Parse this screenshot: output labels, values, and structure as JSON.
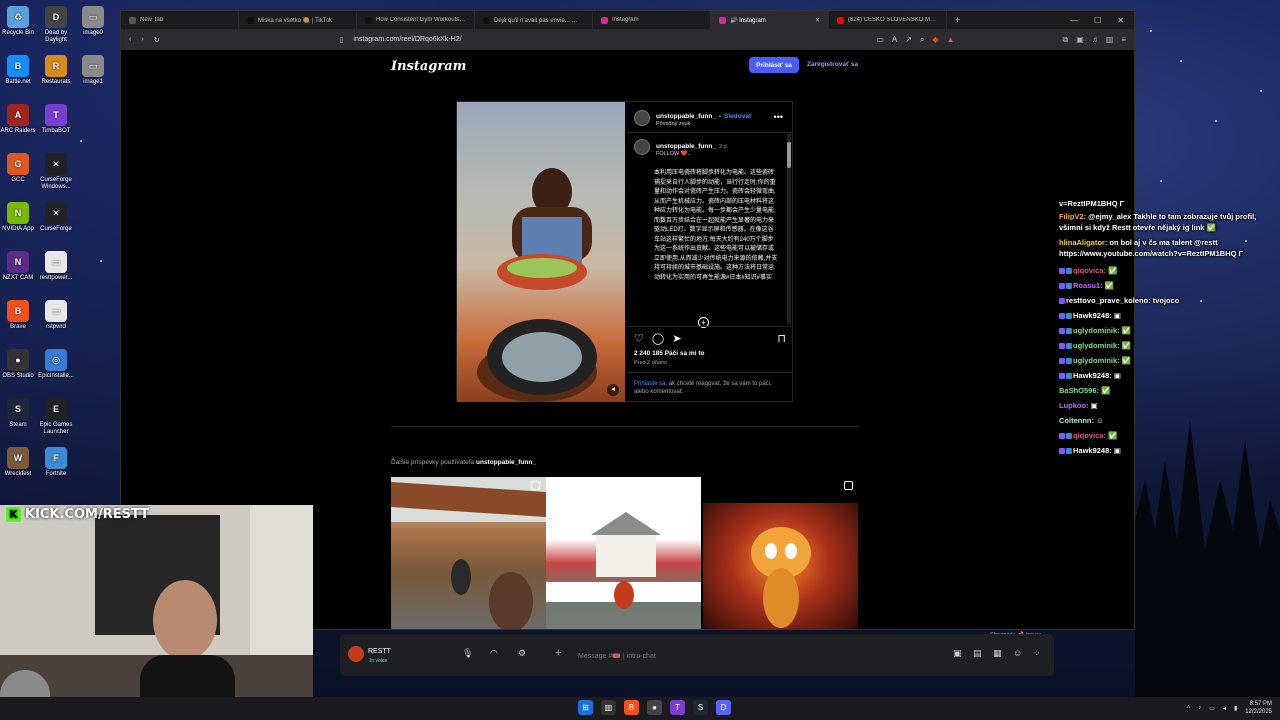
{
  "desktop": {
    "icons": [
      {
        "label": "Recycle Bin",
        "color": "#5aa0d8",
        "glyph": "♻"
      },
      {
        "label": "Dead by Daylight",
        "color": "#444444",
        "glyph": "D"
      },
      {
        "label": "image0",
        "color": "#8a8a8a",
        "glyph": "▭"
      },
      {
        "label": "Battle.net",
        "color": "#148eff",
        "glyph": "B"
      },
      {
        "label": "Restaurats",
        "color": "#d88a1a",
        "glyph": "R"
      },
      {
        "label": "image1",
        "color": "#8a8a8a",
        "glyph": "▭"
      },
      {
        "label": "ARC Raiders",
        "color": "#a2241e",
        "glyph": "A"
      },
      {
        "label": "TimbaBOT",
        "color": "#7b3fd0",
        "glyph": "T"
      },
      {
        "label": "GCC",
        "color": "#e0561f",
        "glyph": "G"
      },
      {
        "label": "CurseForge Windows...",
        "color": "#222222",
        "glyph": "✕"
      },
      {
        "label": "NVIDIA App",
        "color": "#76b900",
        "glyph": "N"
      },
      {
        "label": "CurseForge",
        "color": "#222222",
        "glyph": "✕"
      },
      {
        "label": "NZXT CAM",
        "color": "#5a2b8a",
        "glyph": "N"
      },
      {
        "label": "resttpower...",
        "color": "#e8e8e8",
        "glyph": "▭"
      },
      {
        "label": "Brave",
        "color": "#f1511b",
        "glyph": "B"
      },
      {
        "label": "rstpwrd",
        "color": "#e8e8e8",
        "glyph": "▭"
      },
      {
        "label": "OBS Studio",
        "color": "#333333",
        "glyph": "●"
      },
      {
        "label": "EpicInstalle...",
        "color": "#3a7bd5",
        "glyph": "◎"
      },
      {
        "label": "Steam",
        "color": "#1b2838",
        "glyph": "S"
      },
      {
        "label": "Epic Games Launcher",
        "color": "#222222",
        "glyph": "E"
      },
      {
        "label": "Wreckfest",
        "color": "#7a5a3a",
        "glyph": "W"
      },
      {
        "label": "Fortnite",
        "color": "#3a8ad5",
        "glyph": "F"
      }
    ]
  },
  "browser": {
    "tabs": [
      {
        "title": "New Tab",
        "color": "#555555",
        "active": false
      },
      {
        "title": "Miska na všetko 🥘 | TikTok",
        "color": "#111111",
        "active": false
      },
      {
        "title": "How Consistent Gym Workouts Boo",
        "color": "#111111",
        "active": false
      },
      {
        "title": "Déjà qu'il n'avait pas envie... 😂 #chi",
        "color": "#111111",
        "active": false
      },
      {
        "title": "Instagram",
        "color": "#d6249f",
        "active": false
      },
      {
        "title": "🔊 Instagram",
        "color": "#d6249f",
        "active": true
      },
      {
        "title": "(624) ČESKO SLOVENSKO MÁ TALEN",
        "color": "#ff0000",
        "active": false
      }
    ],
    "url": "instagram.com/reel/DRqo6kXk-H2/"
  },
  "instagram": {
    "logo": "Instagram",
    "login_button": "Prihlásiť sa",
    "signup_link": "Zaregistrovať sa",
    "post": {
      "username": "unstoppable_funn_",
      "separator": "•",
      "follow": "Sledovať",
      "audio": "Pôvodný zvuk",
      "caption_user": "unstoppable_funn_",
      "caption_time": "2 d",
      "caption_first": "FOLLOW ❤️..",
      "caption_text": "本利用压电瓷砖将脚步转化为电能。这些瓷砖捕捉来自行人脚步的动能，当行行走时,你的重量和动作会对瓷砖产生压力。瓷砖会轻微弯曲,从而产生机械应力。瓷砖内部的压电材料将这种应力转化为电能。每一步都会产生少量电能,而数百万步结合在一起就能产生显著的电力来驱动LED灯、数字显示屏和传感器。在像这谷车站这样繁忙的地方,每天大约有240万个脚步为这一系统作出贡献。这些电能可以被储存或立即使用,从而减少对传统电力来源的依赖,并支持可持续的城市基础设施。这种方法将日常运动转化为实用的可再生能源#日本#知识#事实",
      "likes": "2 240 185 Páči sa mi to",
      "time_ago": "Pred 2 dňami",
      "login_prompt_link": "Prihláste sa",
      "login_prompt_rest": ", ak chcete reagovať, že sa vám to páči, alebo komentovať."
    },
    "more_posts_prefix": "Ďalšie príspevky používateľa",
    "more_posts_user": "unstoppable_funn_"
  },
  "chat": [
    {
      "user": "",
      "text": "v=ReztIPM1BHQ Γ",
      "color": "#ffffff",
      "badges": []
    },
    {
      "user": "FilipV2:",
      "text": "@ejmy_alex Takhle to tam zobrazuje tvůj profil, všimni si když Restt otevře nějaký ig link ✅",
      "color": "#f4b13a",
      "badges": []
    },
    {
      "user": "hlinaAligator:",
      "text": "on bol aj v čs ma talent @restt https://www.youtube.com/watch?v=ReztIPM1BHQ Γ",
      "color": "#f4d23a",
      "badges": []
    },
    {
      "user": "qiqovica:",
      "text": "✅",
      "color": "#e0567a",
      "badges": [
        "#7b5cff",
        "#3a8ad5"
      ]
    },
    {
      "user": "Roasu1:",
      "text": "✅",
      "color": "#c56bff",
      "badges": [
        "#7b5cff",
        "#3a8ad5"
      ]
    },
    {
      "user": "resttovo_prave_koleno:",
      "text": "tvojoco",
      "color": "#ffffff",
      "badges": [
        "#7b5cff"
      ]
    },
    {
      "user": "Hawk9248:",
      "text": "▣",
      "color": "#ffffff",
      "badges": [
        "#7b5cff",
        "#3a8ad5"
      ]
    },
    {
      "user": "uglydominik:",
      "text": "✅",
      "color": "#7de08a",
      "badges": [
        "#7b5cff",
        "#3a8ad5"
      ]
    },
    {
      "user": "uglydominik:",
      "text": "✅",
      "color": "#7de08a",
      "badges": [
        "#7b5cff",
        "#3a8ad5"
      ]
    },
    {
      "user": "uglydominik:",
      "text": "✅",
      "color": "#7de08a",
      "badges": [
        "#7b5cff",
        "#3a8ad5"
      ]
    },
    {
      "user": "Hawk9248:",
      "text": "▣",
      "color": "#ffffff",
      "badges": [
        "#7b5cff",
        "#3a8ad5"
      ]
    },
    {
      "user": "BaShO596:",
      "text": "✅",
      "color": "#7de08a",
      "badges": []
    },
    {
      "user": "Lupkoo:",
      "text": "▣",
      "color": "#c56bff",
      "badges": []
    },
    {
      "user": "Coltennn:",
      "text": "☺",
      "color": "#a6f0c0",
      "badges": []
    },
    {
      "user": "qiqovica:",
      "text": "✅",
      "color": "#e0567a",
      "badges": [
        "#7b5cff",
        "#3a8ad5"
      ]
    },
    {
      "user": "Hawk9248:",
      "text": "▣",
      "color": "#ffffff",
      "badges": [
        "#7b5cff",
        "#3a8ad5"
      ]
    }
  ],
  "stream": {
    "kick_label": "KICK.COM/RESTT"
  },
  "discord": {
    "user": "RESTT",
    "status": "In voice",
    "message_placeholder": "Message #🎟️ | intro-chat",
    "slowmode": "Slowmode 📌 tenure"
  },
  "taskbar": {
    "time": "8:57 PM",
    "date": "12/2/2025"
  },
  "colors": {
    "ig_blue": "#4a5df9",
    "kick_green": "#53fc18",
    "link_blue": "#4a8dff"
  }
}
